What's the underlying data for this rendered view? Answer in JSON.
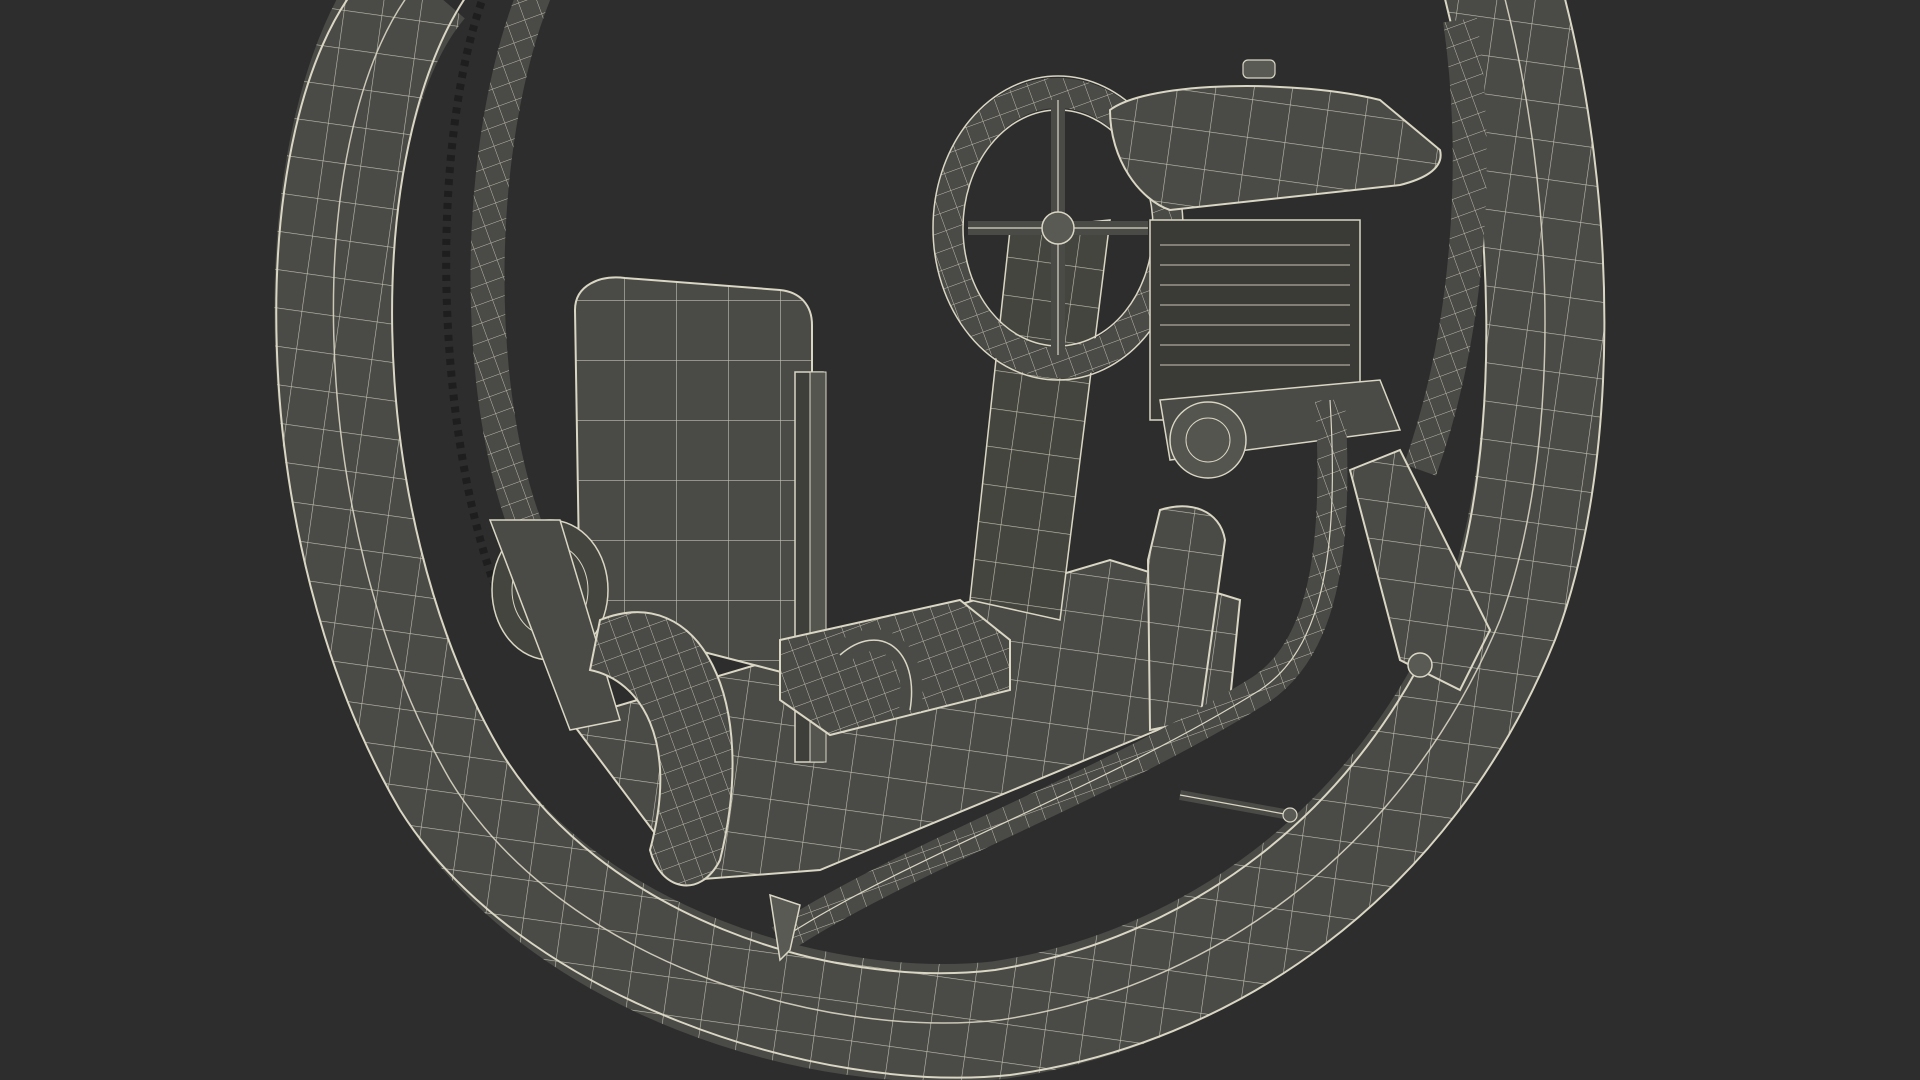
{
  "scene": {
    "subject": "monowheel-wireframe-model",
    "colors": {
      "background": "#2d2d2d",
      "surface": "#4a4a46",
      "surface_dark": "#3a3a37",
      "surface_light": "#5a5a55",
      "wire": "#d9d6c4",
      "wire_dim": "#9c9a8c"
    }
  }
}
